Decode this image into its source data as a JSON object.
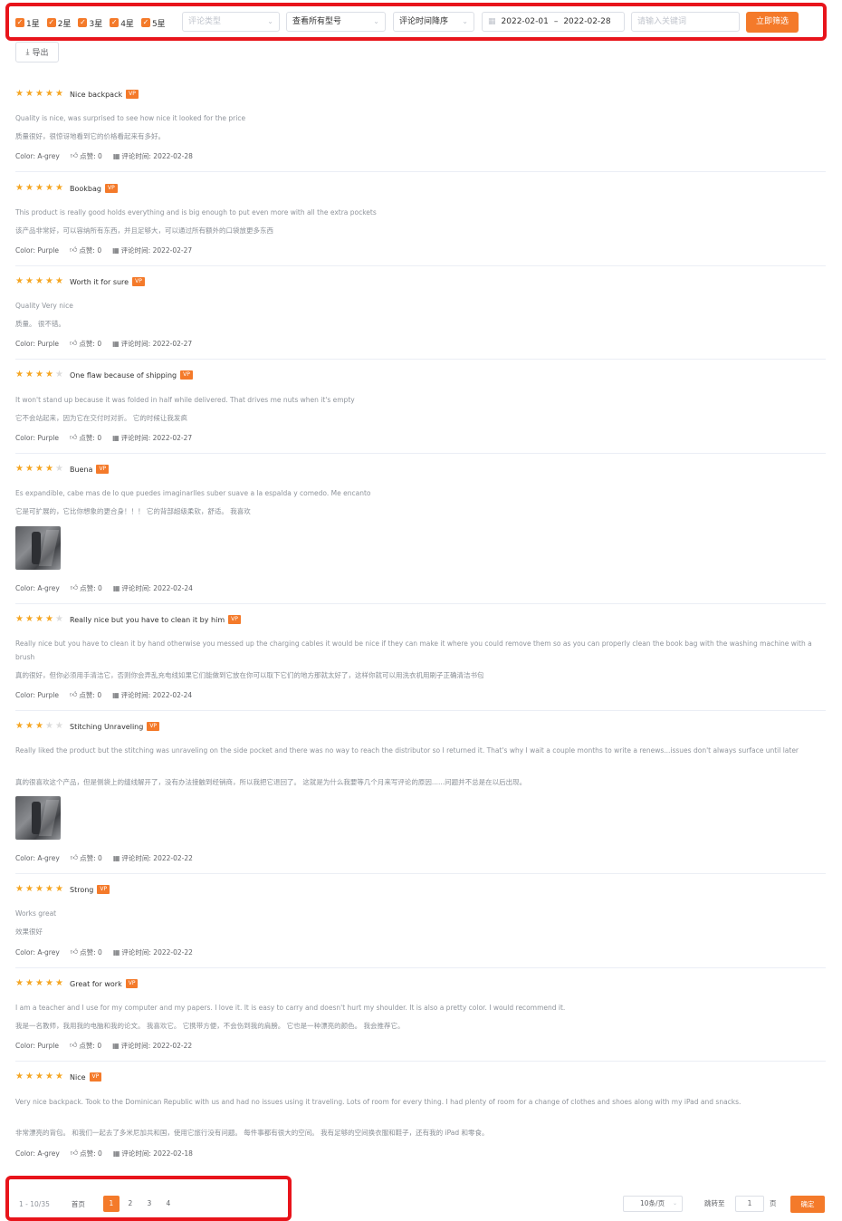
{
  "filters": {
    "star_checkboxes": [
      {
        "label": "1星",
        "checked": true
      },
      {
        "label": "2星",
        "checked": true
      },
      {
        "label": "3星",
        "checked": true
      },
      {
        "label": "4星",
        "checked": true
      },
      {
        "label": "5星",
        "checked": true
      }
    ],
    "comment_type_placeholder": "评论类型",
    "model_select": "查看所有型号",
    "sort_select": "评论时间降序",
    "date_start": "2022-02-01",
    "date_sep": "–",
    "date_end": "2022-02-28",
    "keyword_placeholder": "请输入关键词",
    "apply_button": "立即筛选",
    "export_button": "导出"
  },
  "reviews": [
    {
      "stars": 5,
      "title": "Nice backpack",
      "badge": "VP",
      "en": "Quality is nice, was surprised to see how nice it looked for the price",
      "cn": "质量很好，很惊讶地看到它的价格看起来有多好。",
      "color": "Color: A-grey",
      "likes": "点赞: 0",
      "time": "评论时间: 2022-02-28",
      "has_image": false
    },
    {
      "stars": 5,
      "title": "Bookbag",
      "badge": "VP",
      "en": "This product is really good holds everything and is big enough to put even more with all the extra pockets",
      "cn": "该产品非常好，可以容纳所有东西，并且足够大，可以通过所有额外的口袋放更多东西",
      "color": "Color: Purple",
      "likes": "点赞: 0",
      "time": "评论时间: 2022-02-27",
      "has_image": false
    },
    {
      "stars": 5,
      "title": "Worth it for sure",
      "badge": "VP",
      "en": "Quality Very nice",
      "cn": "质量。 很不错。",
      "color": "Color: Purple",
      "likes": "点赞: 0",
      "time": "评论时间: 2022-02-27",
      "has_image": false
    },
    {
      "stars": 4,
      "title": "One flaw because of shipping",
      "badge": "VP",
      "en": "It won't stand up because it was folded in half while delivered. That drives me nuts when it's empty",
      "cn": "它不会站起来，因为它在交付时对折。 它的时候让我发疯",
      "color": "Color: Purple",
      "likes": "点赞: 0",
      "time": "评论时间: 2022-02-27",
      "has_image": false
    },
    {
      "stars": 4,
      "title": "Buena",
      "badge": "VP",
      "en": "Es expandible, cabe mas de lo que puedes imaginarlles suber suave a la espalda y comedo. Me encanto",
      "cn": "它是可扩展的，它比你想象的更合身！！！ 它的背部超级柔软，舒适。 我喜欢",
      "color": "Color: A-grey",
      "likes": "点赞: 0",
      "time": "评论时间: 2022-02-24",
      "has_image": true
    },
    {
      "stars": 4,
      "title": "Really nice but you have to clean it by him",
      "badge": "VP",
      "en": "Really nice but you have to clean it by hand otherwise you messed up the charging cables it would be nice if they can make it where you could remove them so as you can properly clean the book bag with the washing machine with a brush",
      "cn": "真的很好，但你必须用手清洁它，否则你会弄乱充电线如果它们能做到它放在你可以取下它们的地方那就太好了，这样你就可以用洗衣机用刷子正确清洁书包",
      "color": "Color: Purple",
      "likes": "点赞: 0",
      "time": "评论时间: 2022-02-24",
      "has_image": false
    },
    {
      "stars": 3,
      "title": "Stitching Unraveling",
      "badge": "VP",
      "en": "Really liked the product but the stitching was unraveling on the side pocket and there was no way to reach the distributor so I returned it. That's why I wait a couple months to write a renews...issues don't always surface until later",
      "cn": "真的很喜欢这个产品，但是侧袋上的缝线解开了，没有办法接触到经销商，所以我把它退回了。 这就是为什么我要等几个月来写评论的原因......问题并不总是在以后出现。",
      "color": "Color: A-grey",
      "likes": "点赞: 0",
      "time": "评论时间: 2022-02-22",
      "has_image": true
    },
    {
      "stars": 5,
      "title": "Strong",
      "badge": "VP",
      "en": "Works great",
      "cn": "效果很好",
      "color": "Color: A-grey",
      "likes": "点赞: 0",
      "time": "评论时间: 2022-02-22",
      "has_image": false
    },
    {
      "stars": 5,
      "title": "Great for work",
      "badge": "VP",
      "en": "I am a teacher and I use for my computer and my papers. I love it. It is easy to carry and doesn't hurt my shoulder. It is also a pretty color. I would recommend it.",
      "cn": "我是一名教师，我用我的电脑和我的论文。 我喜欢它。 它携带方便，不会伤到我的肩膀。 它也是一种漂亮的颜色。 我会推荐它。",
      "color": "Color: Purple",
      "likes": "点赞: 0",
      "time": "评论时间: 2022-02-22",
      "has_image": false
    },
    {
      "stars": 5,
      "title": "Nice",
      "badge": "VP",
      "en": "Very nice backpack. Took to the Dominican Republic with us and had no issues using it traveling. Lots of room for every thing. I had plenty of room for a change of clothes and shoes along with my iPad and snacks.",
      "cn": "非常漂亮的背包。 和我们一起去了多米尼加共和国，使用它旅行没有问题。 每件事都有很大的空间。 我有足够的空间换衣服和鞋子，还有我的 iPad 和零食。",
      "color": "Color: A-grey",
      "likes": "点赞: 0",
      "time": "评论时间: 2022-02-18",
      "has_image": false
    }
  ],
  "pagination": {
    "total_text": "1 - 10/35",
    "first_label": "首页",
    "pages": [
      "1",
      "2",
      "3",
      "4"
    ],
    "active_page": "1",
    "page_size": "10条/页",
    "jump_label": "跳转至",
    "jump_value": "1",
    "page_unit": "页",
    "confirm_button": "确定"
  },
  "colors": {
    "accent": "#f47a2a",
    "star": "#f5a623",
    "highlight": "#e8141b"
  }
}
